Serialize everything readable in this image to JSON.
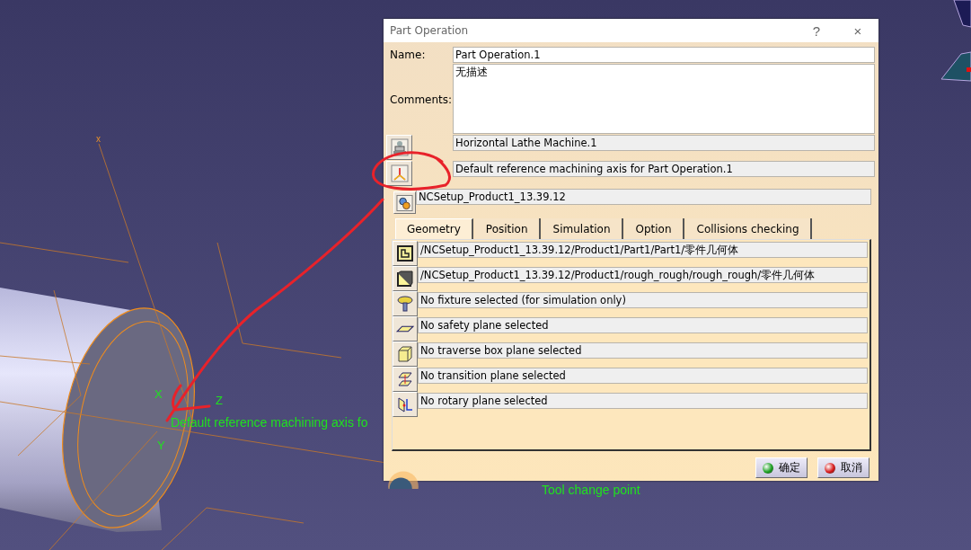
{
  "viewport": {
    "labels": [
      {
        "kind": "axis",
        "text": "x"
      },
      {
        "kind": "axis",
        "text": "X"
      },
      {
        "kind": "axis",
        "text": "Y"
      },
      {
        "kind": "axis",
        "text": "Z"
      },
      {
        "kind": "note",
        "text": "Default reference machining axis fo"
      },
      {
        "kind": "note",
        "text": "Tool change point"
      }
    ]
  },
  "dialog": {
    "title": "Part Operation",
    "help": "?",
    "close": "×",
    "name": {
      "label": "Name:",
      "value": "Part Operation.1"
    },
    "comments": {
      "label": "Comments:",
      "value": "无描述"
    },
    "machine": "Horizontal Lathe Machine.1",
    "axis": "Default reference machining axis for Part Operation.1",
    "setup": "NCSetup_Product1_13.39.12",
    "tabs": [
      {
        "label": "Geometry",
        "selected": true
      },
      {
        "label": "Position",
        "selected": false
      },
      {
        "label": "Simulation",
        "selected": false
      },
      {
        "label": "Option",
        "selected": false
      },
      {
        "label": "Collisions checking",
        "selected": false
      }
    ],
    "geometry_rows": [
      {
        "kind": "part",
        "text": "/NCSetup_Product1_13.39.12/Product1/Part1/Part1/零件几何体"
      },
      {
        "kind": "stock",
        "text": "/NCSetup_Product1_13.39.12/Product1/rough_rough/rough_rough/零件几何体"
      },
      {
        "kind": "fixture",
        "text": "No fixture selected (for simulation only)"
      },
      {
        "kind": "safety",
        "text": "No safety plane selected"
      },
      {
        "kind": "traverse",
        "text": "No traverse box plane selected"
      },
      {
        "kind": "transition",
        "text": "No transition plane selected"
      },
      {
        "kind": "rotary",
        "text": "No rotary plane selected"
      }
    ],
    "buttons": [
      {
        "kind": "ok",
        "label": "确定"
      },
      {
        "kind": "cancel",
        "label": "取消"
      }
    ]
  }
}
